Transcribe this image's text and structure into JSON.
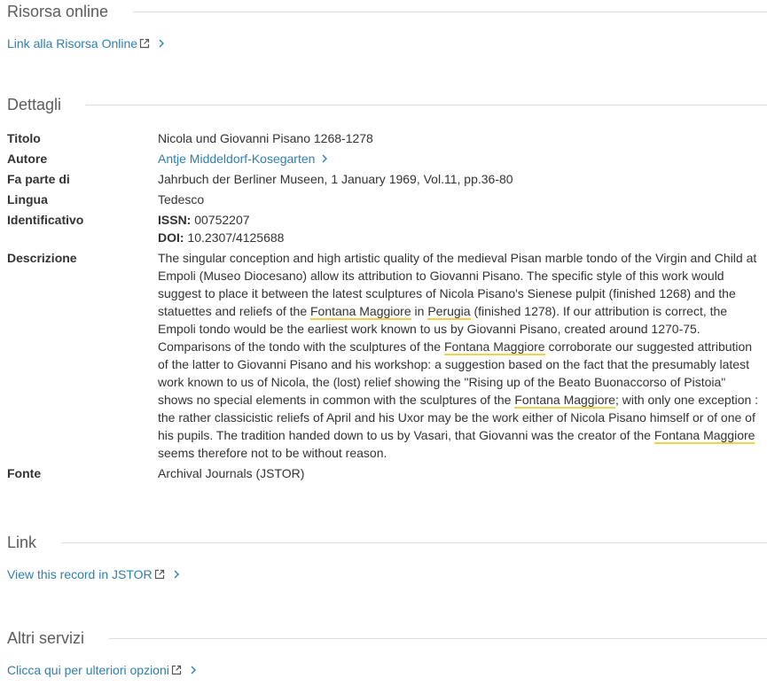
{
  "sections": {
    "online_resource": {
      "title": "Risorsa online",
      "link": "Link alla Risorsa Online"
    },
    "details": {
      "title": "Dettagli",
      "title_label": "Titolo",
      "title_value": "Nicola und Giovanni Pisano 1268-1278",
      "author_label": "Autore",
      "author_value": "Antje Middeldorf-Kosegarten",
      "part_of_label": "Fa parte di",
      "part_of_value": "Jahrbuch der Berliner Museen, 1 January 1969, Vol.11, pp.36-80",
      "language_label": "Lingua",
      "language_value": "Tedesco",
      "identifier_label": "Identificativo",
      "issn_label": "ISSN:",
      "issn_value": " 00752207",
      "doi_label": "DOI:",
      "doi_value": " 10.2307/4125688",
      "description_label": "Descrizione",
      "description_parts": [
        {
          "text": "The singular conception and high artistic quality of the medieval Pisan marble tondo of the Virgin and Child at Empoli (Museo Diocesano) allow its attribution to Giovanni Pisano. The specific style of this work would suggest to place it between the latest sculptures of Nicola Pisano's Sienese pulpit (finished 1268) and the statuettes and reliefs of the ",
          "hl": false
        },
        {
          "text": "Fontana Maggiore",
          "hl": true
        },
        {
          "text": " in ",
          "hl": false
        },
        {
          "text": "Perugia",
          "hl": true
        },
        {
          "text": " (finished 1278). If our attribution is correct, the Empoli tondo would be the earliest work known to us by Giovanni Pisano, created around 1270-75. Comparisons of the tondo with the sculptures of the ",
          "hl": false
        },
        {
          "text": "Fontana Maggiore",
          "hl": true
        },
        {
          "text": " corroborate our suggested attribution of the latter to Giovanni Pisano and his workshop: a suggestion based on the fact that the presumably latest work known to us of Nicola, the (lost) relief showing the \"Rising up of the Beato Buonaccorso of Pistoia\" shows no special elements in common with the sculptures of the ",
          "hl": false
        },
        {
          "text": "Fontana Maggiore",
          "hl": true
        },
        {
          "text": "; with only one exception : the rather classicistic reliefs of April and his Uxor may be the work either of Nicola Pisano himself or of one of his pupils. The tradition handed down to us by Vasari, that Giovanni was the creator of the ",
          "hl": false
        },
        {
          "text": "Fontana Maggiore",
          "hl": true
        },
        {
          "text": " seems therefore not to be without reason.",
          "hl": false
        }
      ],
      "source_label": "Fonte",
      "source_value": "Archival Journals (JSTOR)"
    },
    "link": {
      "title": "Link",
      "link": "View this record in JSTOR"
    },
    "other_services": {
      "title": "Altri servizi",
      "link": "Clicca qui per ulteriori opzioni"
    }
  },
  "icons": {
    "external": "external-link-icon",
    "chevron": "chevron-right-icon"
  },
  "colors": {
    "link": "#2f7fb1",
    "highlight": "#f2d24b",
    "rule": "#dcdcdc",
    "heading": "#5c5c5c"
  }
}
